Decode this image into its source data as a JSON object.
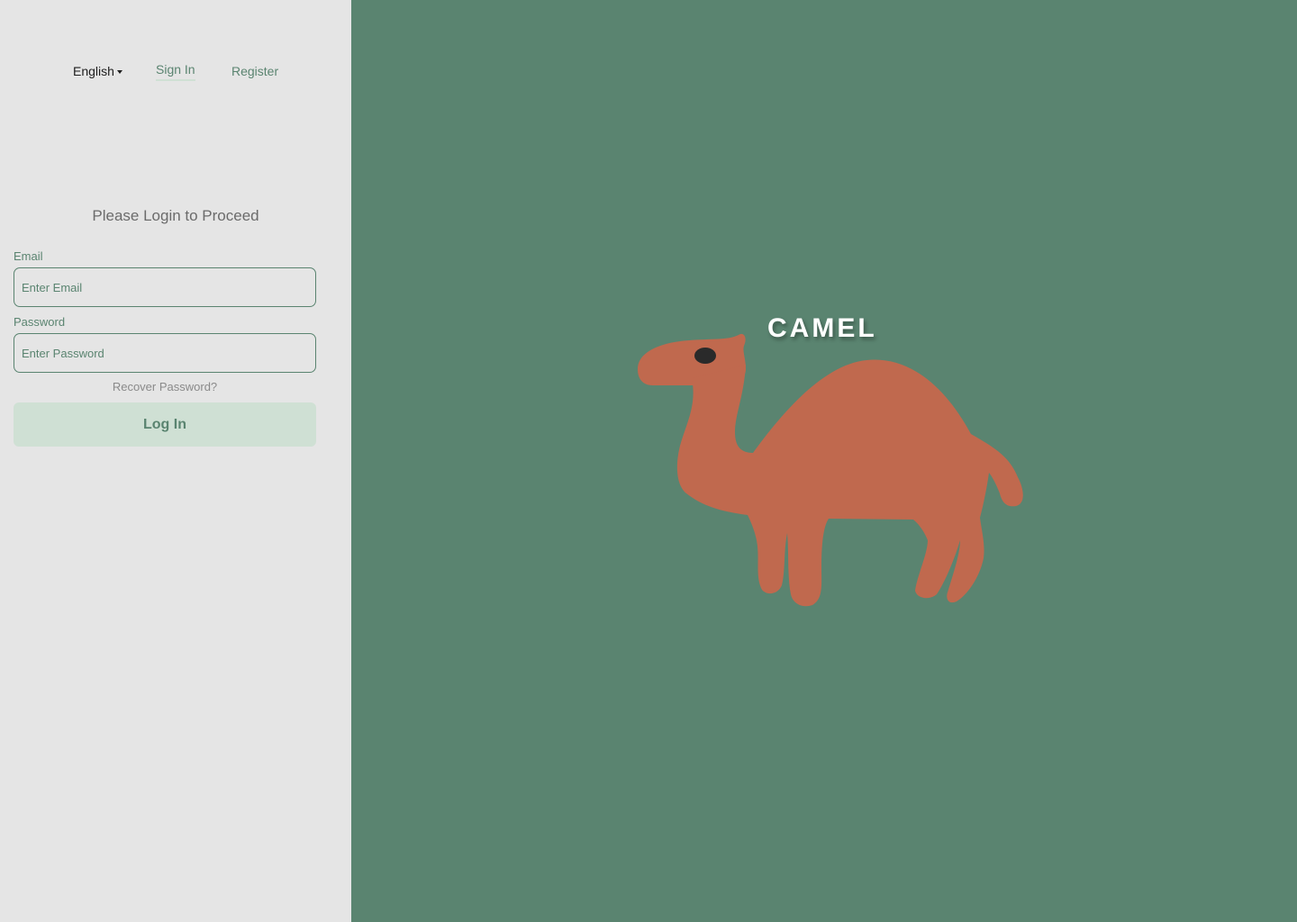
{
  "nav": {
    "language": "English",
    "signin_label": "Sign In",
    "register_label": "Register"
  },
  "login": {
    "heading": "Please Login to Proceed",
    "email_label": "Email",
    "email_placeholder": "Enter Email",
    "email_value": "",
    "password_label": "Password",
    "password_placeholder": "Enter Password",
    "password_value": "",
    "recover_label": "Recover Password?",
    "submit_label": "Log In"
  },
  "brand": {
    "name": "CAMEL"
  },
  "colors": {
    "accent": "#5a8470",
    "left_bg": "#e5e5e5",
    "button_bg": "#cfe0d4",
    "camel": "#c0694e",
    "eye": "#2a2a2a"
  },
  "icons": {
    "language_caret": "caret-down-icon",
    "brand_illustration": "camel-illustration"
  }
}
